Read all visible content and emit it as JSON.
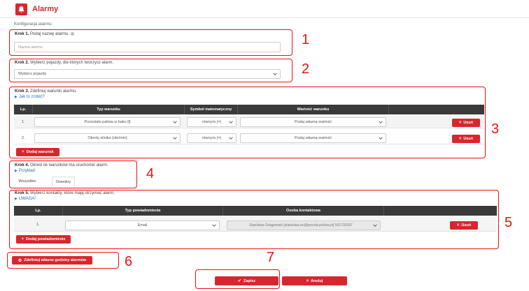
{
  "header": {
    "title": "Alarmy",
    "icon": "bell-icon",
    "accent": "#d9262e"
  },
  "subtitle": "Konfiguracja alarmu:",
  "step1": {
    "label_bold": "Krok 1.",
    "label_text": "Podaj nazwę alarmu.",
    "placeholder": "Nazwa alarmu"
  },
  "step2": {
    "label_bold": "Krok 2.",
    "label_text": "Wybierz pojazdy, dla których tworzysz alarm.",
    "select_value": "Wybierz pojazdy"
  },
  "step3": {
    "label_bold": "Krok 3.",
    "label_text": "Zdefiniuj warunki alarmu.",
    "help_link": "Jak to zrobić?",
    "columns": [
      "Lp.",
      "Typ warunku",
      "Symbol matematyczny",
      "Wartość warunku"
    ],
    "rows": [
      {
        "lp": "1.",
        "type": "Pozostało paliwa w baku [l]",
        "symbol": "równy/a (=)",
        "value": "Podaj własną wartość",
        "delete": "Usuń"
      },
      {
        "lp": "2.",
        "type": "Obroty silnika [obr/min]",
        "symbol": "równy/a (=)",
        "value": "Podaj własną wartość",
        "delete": "Usuń"
      }
    ],
    "add_button": "Dodaj warunek"
  },
  "step4": {
    "label_bold": "Krok 4.",
    "label_text": "Określ ile warunków ma uruchomić alarm.",
    "example_link": "Przykład",
    "tabs": [
      "Wszystkie",
      "Dowolny"
    ]
  },
  "step5": {
    "label_bold": "Krok 5.",
    "label_text": "Wybierz kontakty, które mają otrzymać alarm.",
    "notice_link": "UWAGA!",
    "columns": [
      "Lp.",
      "Typ powiadomienia",
      "Osoba kontaktowa"
    ],
    "rows": [
      {
        "lp": "1.",
        "type": "Email",
        "contact": "Stanisław Żelągowski [stanislaw.zel@poczta-polska.pl] 501730187",
        "delete": "Usuń"
      }
    ],
    "add_button": "Dodaj powiadomienie"
  },
  "hours_button": "Zdefiniuj własne godziny alarmów",
  "save_button": "Zapisz",
  "cancel_button": "Anuluj",
  "annotations": [
    "1",
    "2",
    "3",
    "4",
    "5",
    "6",
    "7"
  ],
  "annotation_color": "#e11111"
}
